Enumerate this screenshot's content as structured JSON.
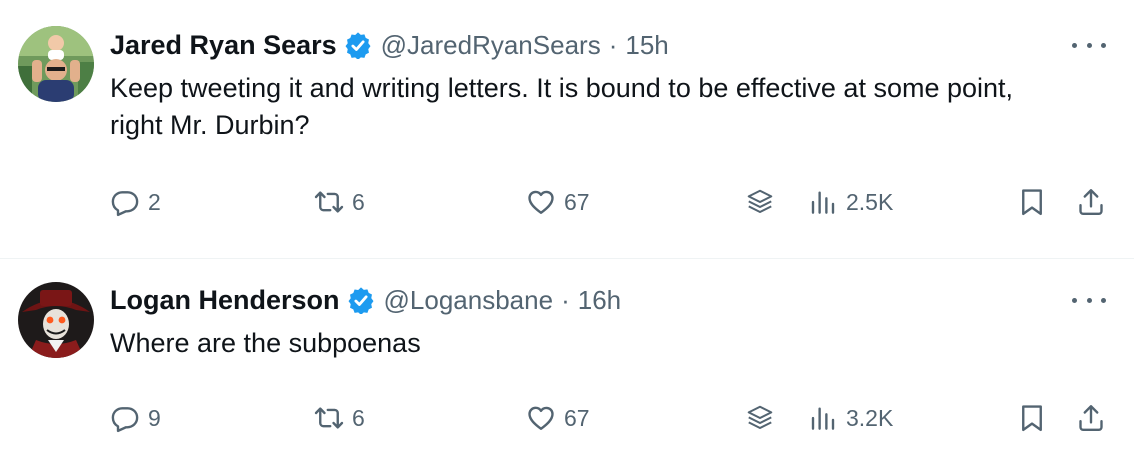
{
  "tweets": [
    {
      "author_name": "Jared Ryan Sears",
      "handle": "@JaredRyanSears",
      "separator": "·",
      "time": "15h",
      "text": "Keep tweeting it and writing letters. It is bound to be effective at some point, right Mr. Durbin?",
      "reply_count": "2",
      "retweet_count": "6",
      "like_count": "67",
      "view_count": "2.5K"
    },
    {
      "author_name": "Logan Henderson",
      "handle": "@Logansbane",
      "separator": "·",
      "time": "16h",
      "text": "Where are the subpoenas",
      "reply_count": "9",
      "retweet_count": "6",
      "like_count": "67",
      "view_count": "3.2K"
    }
  ],
  "icons": {
    "verified": "verified-badge-icon",
    "more": "more-icon",
    "reply": "reply-icon",
    "retweet": "retweet-icon",
    "like": "heart-icon",
    "grok": "grok-stack-icon",
    "views": "views-icon",
    "bookmark": "bookmark-icon",
    "share": "share-icon"
  },
  "colors": {
    "verified_blue": "#1d9bf0",
    "text_primary": "#0f1419",
    "text_secondary": "#536471",
    "divider": "#eff3f4"
  }
}
